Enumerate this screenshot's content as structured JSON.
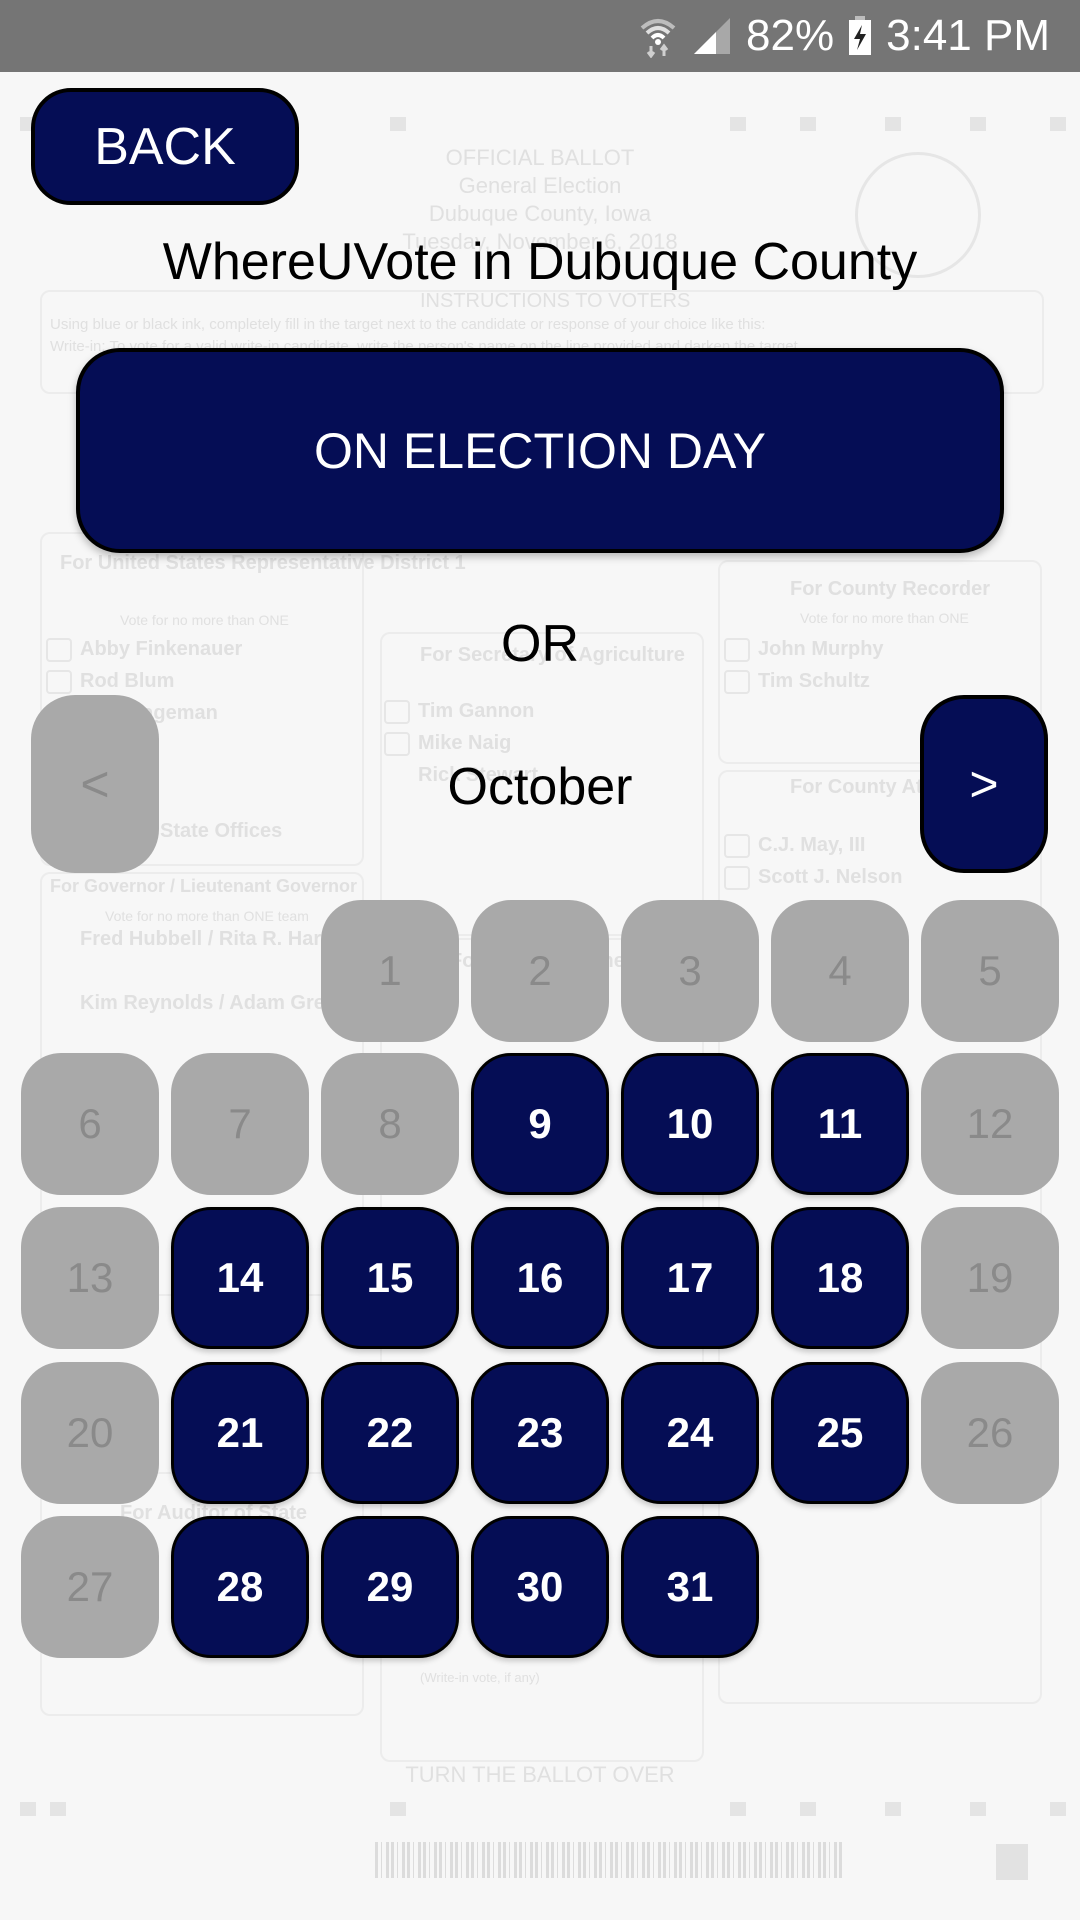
{
  "status_bar": {
    "wifi_icon": "wifi-data-icon",
    "signal_icon": "cell-signal-icon",
    "battery_percent": "82%",
    "battery_icon": "battery-charging-icon",
    "time": "3:41 PM"
  },
  "colors": {
    "primary": "#050d55",
    "disabled": "#a9a9a9",
    "disabled_text": "#8a8a8a",
    "status_bar": "#757575"
  },
  "header": {
    "back_label": "BACK",
    "title": "WhereUVote in Dubuque County"
  },
  "election_day_button": "ON ELECTION DAY",
  "or_label": "OR",
  "calendar": {
    "month": "October",
    "prev_label": "<",
    "next_label": ">",
    "prev_enabled": false,
    "next_enabled": true,
    "first_weekday_index": 2,
    "days": [
      {
        "day": "1",
        "enabled": false
      },
      {
        "day": "2",
        "enabled": false
      },
      {
        "day": "3",
        "enabled": false
      },
      {
        "day": "4",
        "enabled": false
      },
      {
        "day": "5",
        "enabled": false
      },
      {
        "day": "6",
        "enabled": false
      },
      {
        "day": "7",
        "enabled": false
      },
      {
        "day": "8",
        "enabled": false
      },
      {
        "day": "9",
        "enabled": true
      },
      {
        "day": "10",
        "enabled": true
      },
      {
        "day": "11",
        "enabled": true
      },
      {
        "day": "12",
        "enabled": false
      },
      {
        "day": "13",
        "enabled": false
      },
      {
        "day": "14",
        "enabled": true
      },
      {
        "day": "15",
        "enabled": true
      },
      {
        "day": "16",
        "enabled": true
      },
      {
        "day": "17",
        "enabled": true
      },
      {
        "day": "18",
        "enabled": true
      },
      {
        "day": "19",
        "enabled": false
      },
      {
        "day": "20",
        "enabled": false
      },
      {
        "day": "21",
        "enabled": true
      },
      {
        "day": "22",
        "enabled": true
      },
      {
        "day": "23",
        "enabled": true
      },
      {
        "day": "24",
        "enabled": true
      },
      {
        "day": "25",
        "enabled": true
      },
      {
        "day": "26",
        "enabled": false
      },
      {
        "day": "27",
        "enabled": false
      },
      {
        "day": "28",
        "enabled": true
      },
      {
        "day": "29",
        "enabled": true
      },
      {
        "day": "30",
        "enabled": true
      },
      {
        "day": "31",
        "enabled": true
      }
    ]
  },
  "background_ballot": {
    "header_lines": [
      "OFFICIAL BALLOT",
      "General Election",
      "Dubuque County, Iowa",
      "Tuesday, November 6, 2018"
    ],
    "instructions_title": "INSTRUCTIONS TO VOTERS",
    "instructions_line1": "Using blue or black ink, completely fill in the target next to the candidate or response of your choice like this:",
    "instructions_line2": "Write-in: To vote for a valid write-in candidate, write the person's name on the line provided and darken the target.",
    "race_rep": "For United States Representative District 1",
    "vote_one": "Vote for no more than ONE",
    "candidates_rep": [
      "Abby Finkenauer",
      "Rod Blum",
      "Troy Hageman"
    ],
    "race_recorder": "For County Recorder",
    "candidates_recorder": [
      "John Murphy",
      "Tim Schultz"
    ],
    "race_ag": "For Secretary of Agriculture",
    "candidates_ag": [
      "Tim Gannon",
      "Mike Naig",
      "Rick Stewart"
    ],
    "race_attorney": "For County Attorney",
    "candidates_attorney": [
      "C.J. May, III",
      "Scott J. Nelson"
    ],
    "race_state": "State Offices",
    "race_governor": "For Governor / Lieutenant Governor",
    "vote_one_team": "Vote for no more than ONE team",
    "candidates_governor": [
      "Fred Hubbell / Rita R. Hart",
      "Kim Reynolds / Adam Gregg"
    ],
    "race_attorney_general": "For Attorney General",
    "race_auditor": "For Auditor of State",
    "write_in": "(Write-in vote, if any)",
    "turn_over": "TURN THE BALLOT OVER"
  }
}
